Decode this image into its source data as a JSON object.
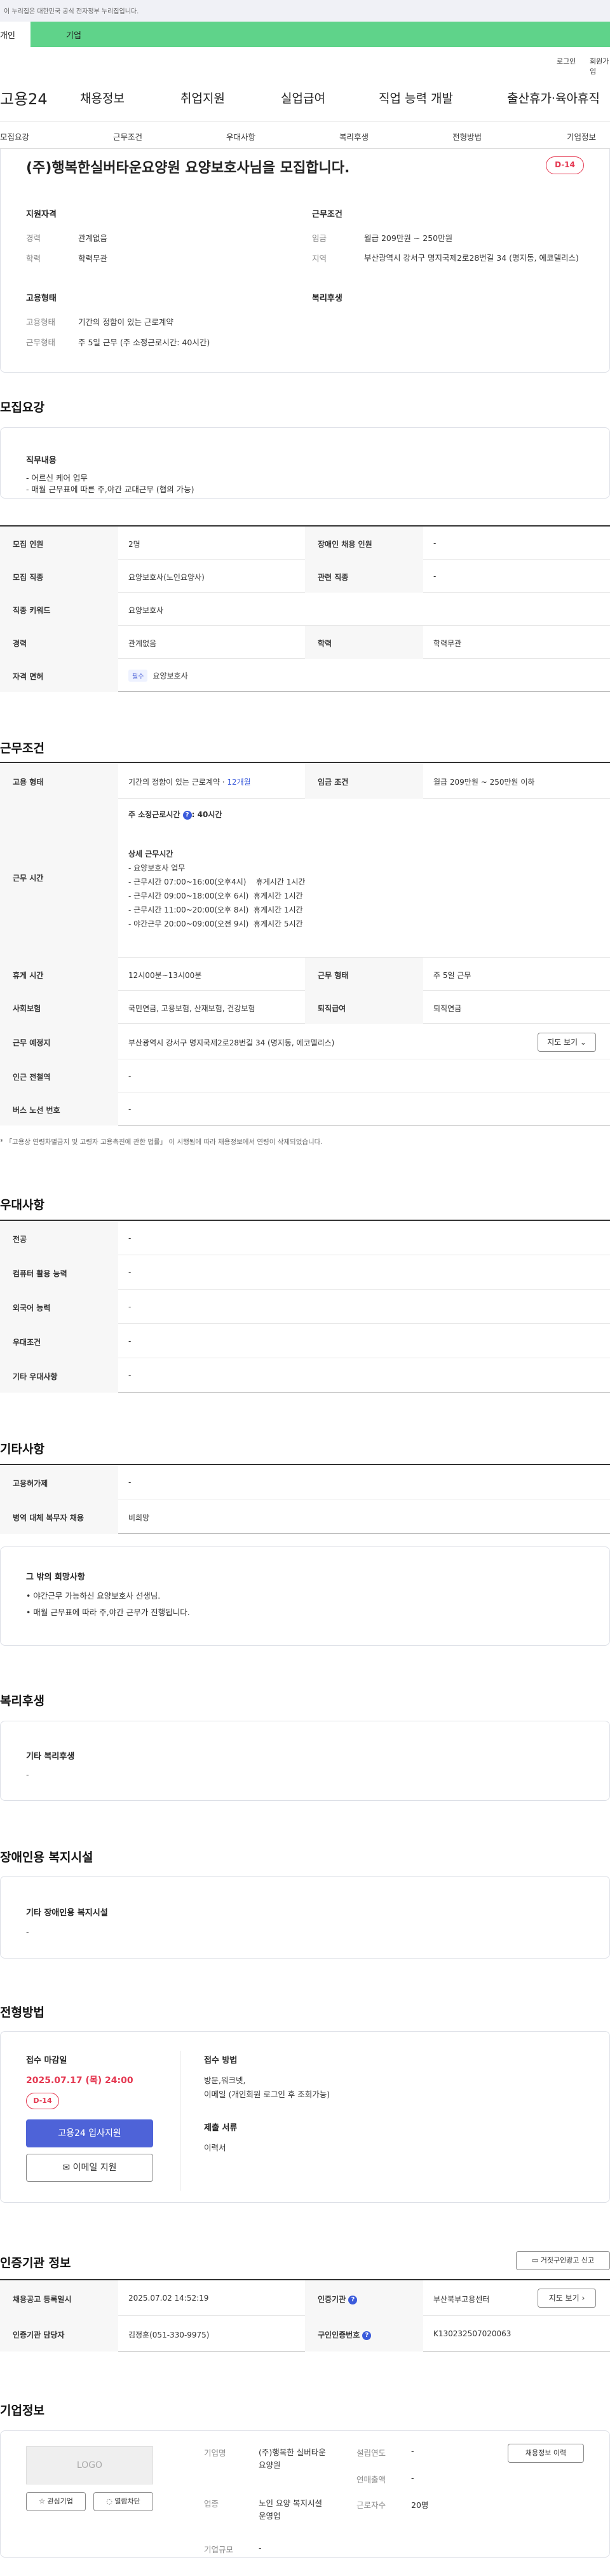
{
  "top_notice": "이 누리집은 대한민국 공식 전자정부 누리집입니다.",
  "bar": {
    "left_label": "개인",
    "right_label": "기업"
  },
  "util": {
    "login": "로그인",
    "join": "회원가입"
  },
  "logo": "고용24",
  "gnb": [
    "채용정보",
    "취업지원",
    "실업급여",
    "직업 능력 개발",
    "출산휴가·육아휴직"
  ],
  "tabs": [
    "모집요강",
    "근무조건",
    "우대사항",
    "복리후생",
    "전형방법",
    "기업정보"
  ],
  "summary": {
    "title": "(주)행복한실버타운요양원 요양보호사님을 모집합니다.",
    "dday": "D-14",
    "qual_title": "지원자격",
    "career_lbl": "경력",
    "career_val": "관계없음",
    "edu_lbl": "학력",
    "edu_val": "학력무관",
    "cond_title": "근무조건",
    "wage_lbl": "임금",
    "wage_val": "월급 209만원 ~ 250만원",
    "region_lbl": "지역",
    "region_val": "부산광역시 강서구 명지국제2로28번길 34 (명지동, 에코델리스)",
    "emp_title": "고용형태",
    "emptype_lbl": "고용형태",
    "emptype_val": "기간의 정함이 있는 근로계약",
    "worktype_lbl": "근무형태",
    "worktype_val": "주 5일 근무 (주 소정근로시간: 40시간)",
    "welfare_title": "복리후생"
  },
  "recruit": {
    "section": "모집요강",
    "duty_title": "직무내용",
    "duty_lines": [
      "- 어르신 케어 업무",
      "- 매월 근무표에 따른 주,야간 교대근무 (협의 가능)"
    ],
    "rows": [
      {
        "k1": "모집 인원",
        "v1": "2명",
        "k2": "장애인 채용 인원",
        "v2": "-"
      },
      {
        "k1": "모집 직종",
        "v1": "요양보호사(노인요양사)",
        "k2": "관련 직종",
        "v2": "-"
      },
      {
        "k1": "직종 키워드",
        "v1": "요양보호사",
        "k2": "",
        "v2": ""
      },
      {
        "k1": "경력",
        "v1": "관계없음",
        "k2": "학력",
        "v2": "학력무관"
      }
    ],
    "license_k": "자격 면허",
    "license_tag": "필수",
    "license_v": "요양보호사"
  },
  "work": {
    "section": "근무조건",
    "emp_k": "고용 형태",
    "emp_v": "기간의 정함이 있는 근로계약 · ",
    "emp_v_blue": "12개월",
    "wage_k": "임금 조건",
    "wage_v": "월급 209만원 ~ 250만원 이하",
    "time_k": "근무 시간",
    "time_head": "주 소정근로시간 ",
    "time_head_b": ": 40시간",
    "time_detail_title": "상세 근무시간",
    "time_lines": [
      "- 요양보호사 업무",
      "- 근무시간 07:00~16:00(오후4시)    휴게시간 1시간",
      "- 근무시간 09:00~18:00(오후 6시)  휴게시간 1시간",
      "- 근무시간 11:00~20:00(오후 8시)  휴게시간 1시간",
      "- 야간근무 20:00~09:00(오전 9시)  휴게시간 5시간"
    ],
    "rest_k": "휴게 시간",
    "rest_v": "12시00분~13시00분",
    "form_k": "근무 형태",
    "form_v": "주 5일 근무",
    "ins_k": "사회보험",
    "ins_v": "국민연금, 고용보험, 산재보험, 건강보험",
    "ret_k": "퇴직급여",
    "ret_v": "퇴직연금",
    "place_k": "근무 예정지",
    "place_v": "부산광역시 강서구 명지국제2로28번길 34 (명지동, 에코델리스)",
    "map_btn": "지도 보기",
    "subway_k": "인근 전철역",
    "subway_v": "-",
    "bus_k": "버스 노선 번호",
    "bus_v": "-",
    "note": "* 「고용상 연령차별금지 및 고령자 고용촉진에 관한 법률」 이 시행됨에 따라 채용정보에서 연령이 삭제되었습니다."
  },
  "pref": {
    "section": "우대사항",
    "rows": [
      {
        "k": "전공",
        "v": "-"
      },
      {
        "k": "컴퓨터 활용 능력",
        "v": "-"
      },
      {
        "k": "외국어 능력",
        "v": "-"
      },
      {
        "k": "우대조건",
        "v": "-"
      },
      {
        "k": "기타 우대사항",
        "v": "-"
      }
    ]
  },
  "etc": {
    "section": "기타사항",
    "rows": [
      {
        "k": "고용허가제",
        "v": "-"
      },
      {
        "k": "병역 대체 복무자 채용",
        "v": "비희망"
      }
    ],
    "box_title": "그 밖의 희망사항",
    "box_lines": [
      "• 야간근무 가능하신 요양보호사 선생님.",
      "• 매월 근무표에 따라 주,야간 근무가 진행됩니다."
    ]
  },
  "welfare": {
    "section": "복리후생",
    "box_title": "기타 복리후생",
    "box_value": "-"
  },
  "disab": {
    "section": "장애인용 복지시설",
    "box_title": "기타 장애인용 복지시설",
    "box_value": "-"
  },
  "apply": {
    "section": "전형방법",
    "deadline_lbl": "접수 마감일",
    "deadline_val": "2025.07.17 (목) 24:00",
    "dday": "D-14",
    "btn_apply": "고용24 입사지원",
    "btn_email": "이메일 지원",
    "method_lbl": "접수 방법",
    "method_lines": [
      "방문,워크넷,",
      "이메일 (개인회원 로그인 후 조회가능)"
    ],
    "docs_lbl": "제출 서류",
    "docs_val": "이력서"
  },
  "cert": {
    "section": "인증기관 정보",
    "report_btn": "거짓구인광고 신고",
    "reg_k": "채용공고 등록일시",
    "reg_v": "2025.07.02 14:52:19",
    "org_k": "인증기관",
    "org_v": "부산북부고용센터",
    "map_btn": "지도 보기",
    "mgr_k": "인증기관 담당자",
    "mgr_v": "김정훈(051-330-9975)",
    "num_k": "구인인증번호",
    "num_v": "K130232507020063"
  },
  "company": {
    "section": "기업정보",
    "logo_text": "LOGO",
    "btn_interest": "관심기업",
    "btn_block": "열람차단",
    "name_k": "기업명",
    "name_v": "(주)행복한 실버타운 요양원",
    "year_k": "설립연도",
    "year_v": "-",
    "sales_k": "연매출액",
    "sales_v": "-",
    "ind_k": "업종",
    "ind_v": "노인 요양 복지시설 운영업",
    "staff_k": "근로자수",
    "staff_v": "20명",
    "size_k": "기업규모",
    "size_v": "-",
    "history_btn": "채용정보 이력"
  }
}
